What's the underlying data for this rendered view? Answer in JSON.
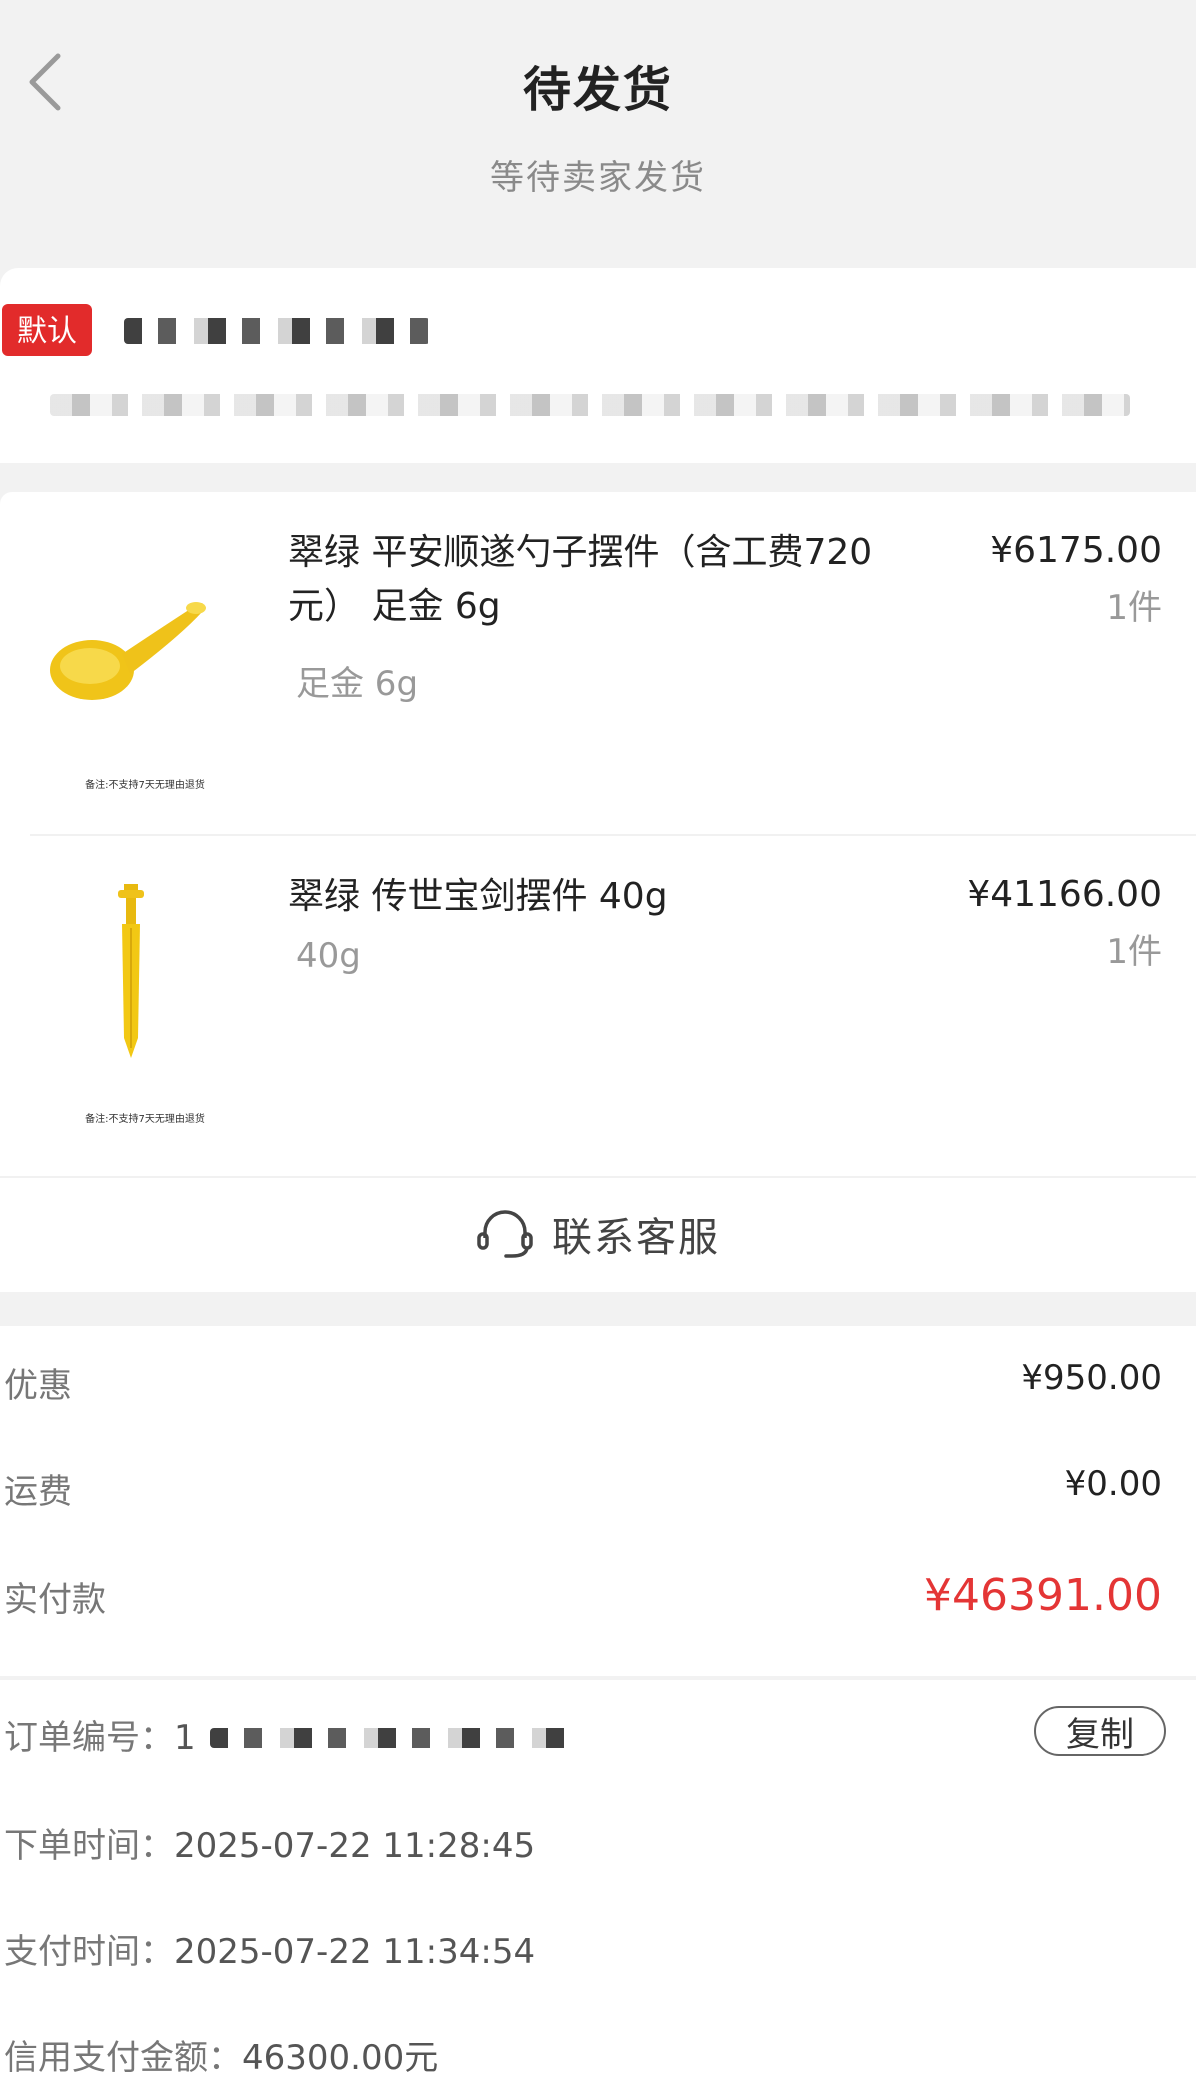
{
  "header": {
    "title": "待发货",
    "subtitle": "等待卖家发货"
  },
  "address": {
    "default_badge": "默认"
  },
  "products": [
    {
      "name": "翠绿  平安顺遂勺子摆件（含工费720元） 足金 6g",
      "spec": "足金 6g",
      "price": "¥6175.00",
      "qty": "1件",
      "image_note": "备注:不支持7天无理由退货"
    },
    {
      "name": "翠绿 传世宝剑摆件 40g",
      "spec": "40g",
      "price": "¥41166.00",
      "qty": "1件",
      "image_note": "备注:不支持7天无理由退货"
    }
  ],
  "customer_service": {
    "label": "联系客服",
    "icon": "headset-icon"
  },
  "fees": {
    "discount_label": "优惠",
    "discount_value": "¥950.00",
    "shipping_label": "运费",
    "shipping_value": "¥0.00",
    "paid_label": "实付款",
    "paid_value": "¥46391.00"
  },
  "order_info": {
    "order_no_label": "订单编号：",
    "order_no_visible": "1",
    "copy_label": "复制",
    "order_time_label": "下单时间：",
    "order_time": "2025-07-22 11:28:45",
    "pay_time_label": "支付时间：",
    "pay_time": "2025-07-22 11:34:54",
    "credit_label": "信用支付金额：",
    "credit_value": "46300.00元"
  },
  "colors": {
    "accent_red": "#e43535",
    "badge_red": "#e22b2b",
    "gold": "#f2c814"
  }
}
